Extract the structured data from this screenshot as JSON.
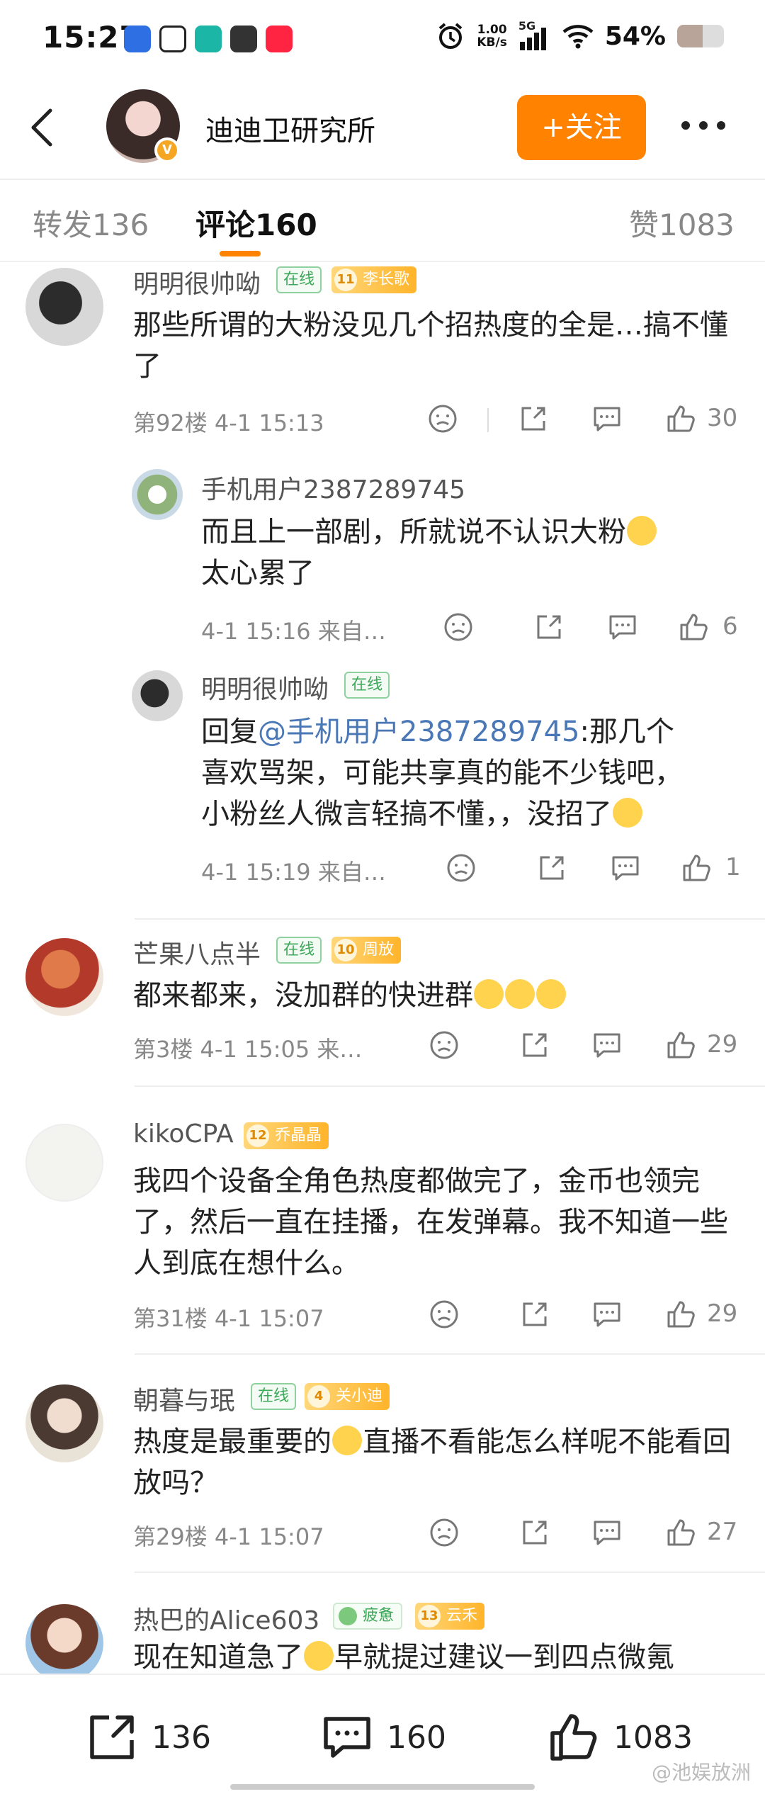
{
  "status_bar": {
    "time": "15:27",
    "net_speed_top": "1.00",
    "net_speed_bottom": "KB/s",
    "signal": "5G",
    "battery": "54%",
    "battery_level": 0.54
  },
  "header": {
    "title": "迪迪卫研究所",
    "follow_label": "+关注"
  },
  "tabs": [
    {
      "label": "转发136"
    },
    {
      "label": "评论160"
    },
    {
      "label": "赞1083"
    }
  ],
  "comments": [
    {
      "user": "明明很帅呦",
      "online": "在线",
      "fan_level": "11",
      "fan_name": "李长歌",
      "text": "那些所谓的大粉没见几个招热度的全是…搞不懂了",
      "meta": "第92楼  4-1 15:13",
      "likes": "30",
      "replies": [
        {
          "user": "手机用户2387289745",
          "text": "而且上一部剧，所就说不认识大粉",
          "text2": "太心累了",
          "meta": "4-1 15:16  来自…",
          "likes": "6"
        },
        {
          "user": "明明很帅呦",
          "online": "在线",
          "prefix": "回复",
          "mention": "@手机用户2387289745",
          "text_a": ":那几个",
          "text_b": "喜欢骂架，可能共享真的能不少钱吧，",
          "text_c": "小粉丝人微言轻搞不懂，，没招了",
          "meta": "4-1 15:19  来自…",
          "likes": "1"
        }
      ]
    },
    {
      "user": "芒果八点半",
      "online": "在线",
      "fan_level": "10",
      "fan_name": "周放",
      "text": "都来都来，没加群的快进群",
      "meta": "第3楼  4-1 15:05  来…",
      "likes": "29"
    },
    {
      "user": "kikoCPA",
      "fan_level": "12",
      "fan_name": "乔晶晶",
      "text": "我四个设备全角色热度都做完了，金币也领完了，然后一直在挂播，在发弹幕。我不知道一些人到底在想什么。",
      "meta": "第31楼  4-1 15:07",
      "likes": "29"
    },
    {
      "user": "朝暮与珉",
      "online": "在线",
      "fan_level": "4",
      "fan_name": "关小迪",
      "text_a": "热度是最重要的",
      "text_b": "直播不看能怎么样呢不能看回放吗？",
      "meta": "第29楼  4-1 15:07",
      "likes": "27"
    },
    {
      "user": "热巴的Alice603",
      "tired": "疲惫",
      "fan_level": "13",
      "fan_name": "云禾",
      "text_a": "现在知道急了",
      "text_b": "早就提过建议一到四点微氪"
    }
  ],
  "bottom_bar": {
    "repost": "136",
    "comment": "160",
    "like": "1083",
    "watermark": "@池娱放洲"
  }
}
